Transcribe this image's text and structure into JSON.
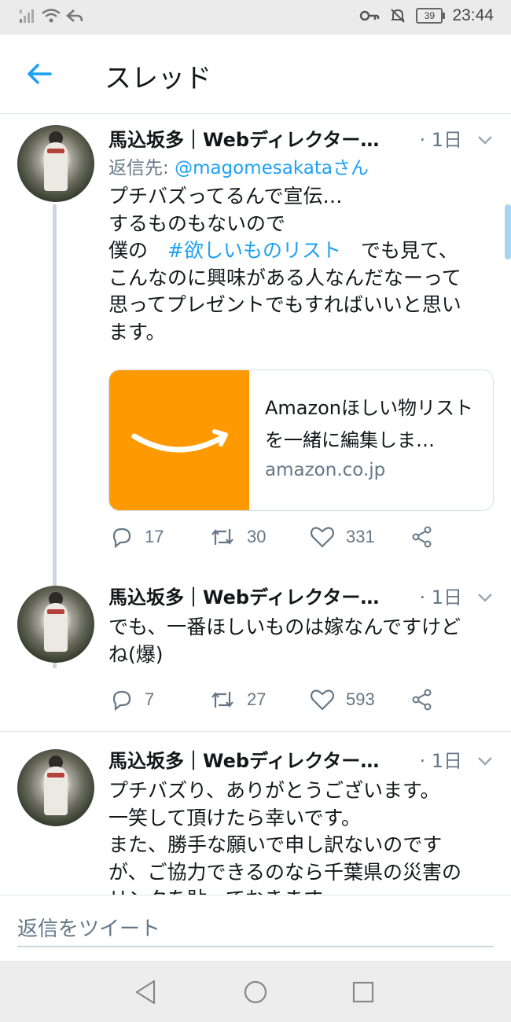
{
  "status_bar": {
    "time": "23:44",
    "battery": "39"
  },
  "header": {
    "title": "スレッド"
  },
  "tweets": [
    {
      "author": "馬込坂多｜Webディレクター…",
      "time": "· 1日",
      "reply_prefix": "返信先: ",
      "reply_handle": "@magomesakataさん",
      "text_before": "プチバズってるんで宣伝…\nするものもないので\n僕の　",
      "hashtag": "#欲しいものリスト",
      "text_after": "　でも見て、\nこんなのに興味がある人なんだなーって\n思ってプレゼントでもすればいいと思い\nます。",
      "card": {
        "title": "Amazonほしい物リストを一緒に編集しま…",
        "domain": "amazon.co.jp"
      },
      "replies": "17",
      "retweets": "30",
      "likes": "331"
    },
    {
      "author": "馬込坂多｜Webディレクター…",
      "time": "· 1日",
      "text": "でも、一番ほしいものは嫁なんですけど\nね(爆)",
      "replies": "7",
      "retweets": "27",
      "likes": "593"
    },
    {
      "author": "馬込坂多｜Webディレクター…",
      "time": "· 1日",
      "text": "プチバズり、ありがとうございます。\n一笑して頂けたら幸いです。\nまた、勝手な願いで申し訳ないのです\nが、ご協力できるのなら千葉県の災害の\nリンクを貼っておきます。"
    }
  ],
  "reply_bar": {
    "placeholder": "返信をツイート"
  },
  "colors": {
    "accent": "#1da1f2",
    "amazon": "#ff9900",
    "muted": "#657786"
  }
}
